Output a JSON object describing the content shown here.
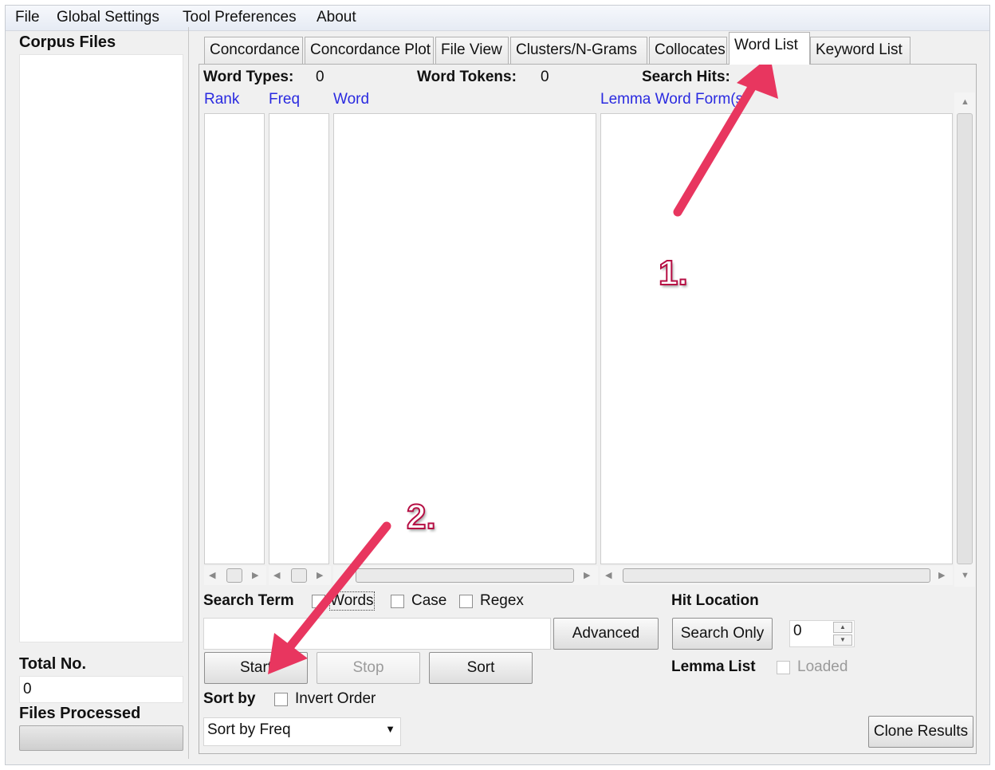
{
  "menu": {
    "file": "File",
    "global_settings": "Global Settings",
    "tool_preferences": "Tool Preferences",
    "about": "About"
  },
  "sidebar": {
    "corpus_files_label": "Corpus Files",
    "total_no_label": "Total No.",
    "total_no_value": "0",
    "files_processed_label": "Files Processed"
  },
  "tabs": [
    {
      "label": "Concordance"
    },
    {
      "label": "Concordance Plot"
    },
    {
      "label": "File View"
    },
    {
      "label": "Clusters/N-Grams"
    },
    {
      "label": "Collocates"
    },
    {
      "label": "Word List",
      "active": true
    },
    {
      "label": "Keyword List"
    }
  ],
  "stats": {
    "word_types_label": "Word Types:",
    "word_types_value": "0",
    "word_tokens_label": "Word Tokens:",
    "word_tokens_value": "0",
    "search_hits_label": "Search Hits:"
  },
  "columns": {
    "rank": "Rank",
    "freq": "Freq",
    "word": "Word",
    "lemma": "Lemma Word Form(s)"
  },
  "search": {
    "term_label": "Search Term",
    "words_label": "Words",
    "words_checked": false,
    "case_label": "Case",
    "case_checked": false,
    "regex_label": "Regex",
    "regex_checked": false,
    "input_value": "",
    "advanced_button": "Advanced"
  },
  "hit_location": {
    "label": "Hit Location",
    "search_only_button": "Search Only",
    "value": "0"
  },
  "actions": {
    "start": "Start",
    "stop": "Stop",
    "sort": "Sort"
  },
  "lemma_list": {
    "label": "Lemma List",
    "loaded_label": "Loaded"
  },
  "sort_by": {
    "label": "Sort by",
    "invert_label": "Invert Order",
    "selected": "Sort by Freq"
  },
  "clone_results_button": "Clone Results",
  "annotations": {
    "step1": "1.",
    "step2": "2."
  },
  "colors": {
    "annotation_arrow": "#e8365f",
    "column_header": "#2a2ae0"
  }
}
